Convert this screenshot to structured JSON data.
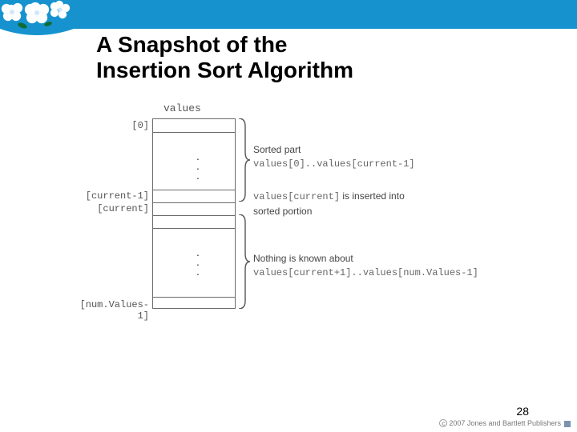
{
  "title_line1": "A  Snapshot of the",
  "title_line2": "Insertion Sort Algorithm",
  "values_label": "values",
  "indices": {
    "top": "[0]",
    "cur_minus1": "[current-1]",
    "cur": "[current]",
    "bottom": "[num.Values-1]"
  },
  "annotations": {
    "sorted_heading": "Sorted part",
    "sorted_range": "values[0]..values[current-1]",
    "insert_code": "values[current]",
    "insert_text": " is inserted into",
    "insert_text2": "sorted portion",
    "unknown_heading": "Nothing is known about",
    "unknown_range": "values[current+1]..values[num.Values-1]"
  },
  "page_number": "28",
  "copyright": "2007 Jones and Bartlett Publishers",
  "dots": "..."
}
